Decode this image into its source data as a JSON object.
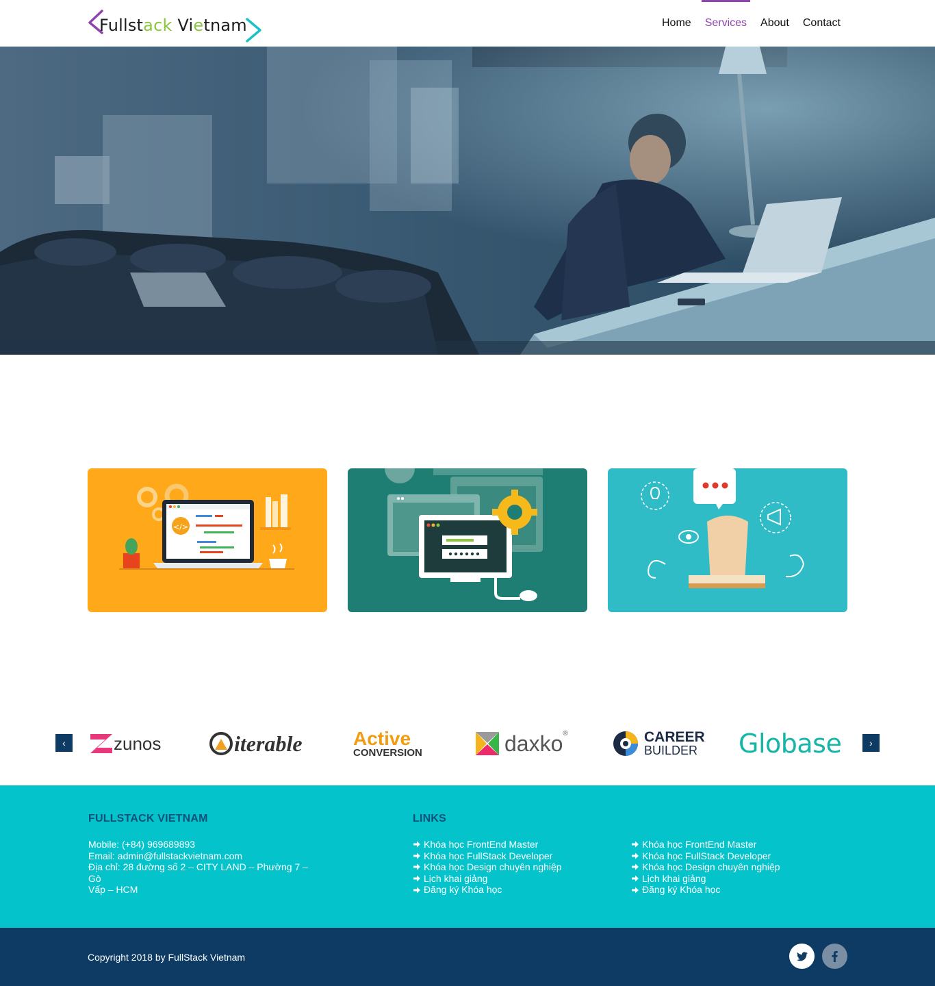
{
  "header": {
    "logo": {
      "part1": "Fullst",
      "part2": "ack",
      "part3": " Vi",
      "part4": "e",
      "part5": "tnam"
    },
    "nav": [
      {
        "label": "Home",
        "active": false
      },
      {
        "label": "Services",
        "active": true
      },
      {
        "label": "About",
        "active": false
      },
      {
        "label": "Contact",
        "active": false
      }
    ]
  },
  "partners": {
    "prev_symbol": "‹",
    "next_symbol": "›",
    "logos": [
      {
        "text": "zunos",
        "color": "#333333",
        "accent": "#e6387a"
      },
      {
        "text": "iterable",
        "color": "#333333",
        "accent": "#f0a020"
      },
      {
        "text": "Active",
        "sub": "CONVERSION",
        "color": "#f39c12",
        "sub_color": "#333333"
      },
      {
        "text": "daxko",
        "reg": "®",
        "color": "#555555"
      },
      {
        "text": "CAREER",
        "sub": "BUILDER",
        "reg": "®",
        "color": "#1b2b46"
      },
      {
        "text": "Globase",
        "color": "#16b5a8"
      }
    ]
  },
  "footer": {
    "company": {
      "title": "FULLSTACK VIETNAM",
      "mobile": "Mobile: (+84) 969689893",
      "email": "Email: admin@fullstackvietnam.com",
      "address_1": "Địa chỉ: 28 đường số 2 – CITY LAND – Phường 7 – Gò",
      "address_2": "Vấp – HCM"
    },
    "links_title": "LINKS",
    "links_col1": [
      "Khóa học FrontEnd Master",
      "Khóa học FullStack Developer",
      "Khóa học Design chuyên nghiệp",
      "Lịch khai giảng",
      "Đăng ký Khóa học"
    ],
    "links_col2": [
      "Khóa học FrontEnd Master",
      "Khóa học FullStack Developer",
      "Khóa học Design chuyên nghiệp",
      "Lịch khai giảng",
      "Đăng ký Khóa học"
    ],
    "copyright": "Copyright 2018 by FullStack Vietnam"
  },
  "colors": {
    "brand_purple": "#8e44ad",
    "brand_green": "#8cc63f",
    "footer_teal": "#05c3cb",
    "footer_navy": "#0d3b63"
  },
  "icons": {
    "link_arrow": "arrow-right-icon",
    "twitter": "twitter-icon",
    "facebook": "facebook-icon"
  }
}
